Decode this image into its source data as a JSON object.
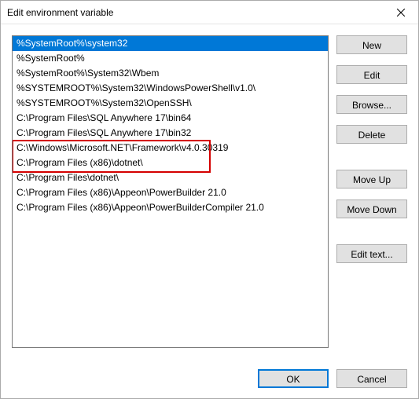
{
  "window": {
    "title": "Edit environment variable"
  },
  "list": {
    "items": [
      "%SystemRoot%\\system32",
      "%SystemRoot%",
      "%SystemRoot%\\System32\\Wbem",
      "%SYSTEMROOT%\\System32\\WindowsPowerShell\\v1.0\\",
      "%SYSTEMROOT%\\System32\\OpenSSH\\",
      "C:\\Program Files\\SQL Anywhere 17\\bin64",
      "C:\\Program Files\\SQL Anywhere 17\\bin32",
      "C:\\Windows\\Microsoft.NET\\Framework\\v4.0.30319",
      "C:\\Program Files (x86)\\dotnet\\",
      "C:\\Program Files\\dotnet\\",
      "C:\\Program Files (x86)\\Appeon\\PowerBuilder 21.0",
      "C:\\Program Files (x86)\\Appeon\\PowerBuilderCompiler 21.0"
    ],
    "selected_index": 0
  },
  "buttons": {
    "new": "New",
    "edit": "Edit",
    "browse": "Browse...",
    "delete": "Delete",
    "move_up": "Move Up",
    "move_down": "Move Down",
    "edit_text": "Edit text...",
    "ok": "OK",
    "cancel": "Cancel"
  }
}
